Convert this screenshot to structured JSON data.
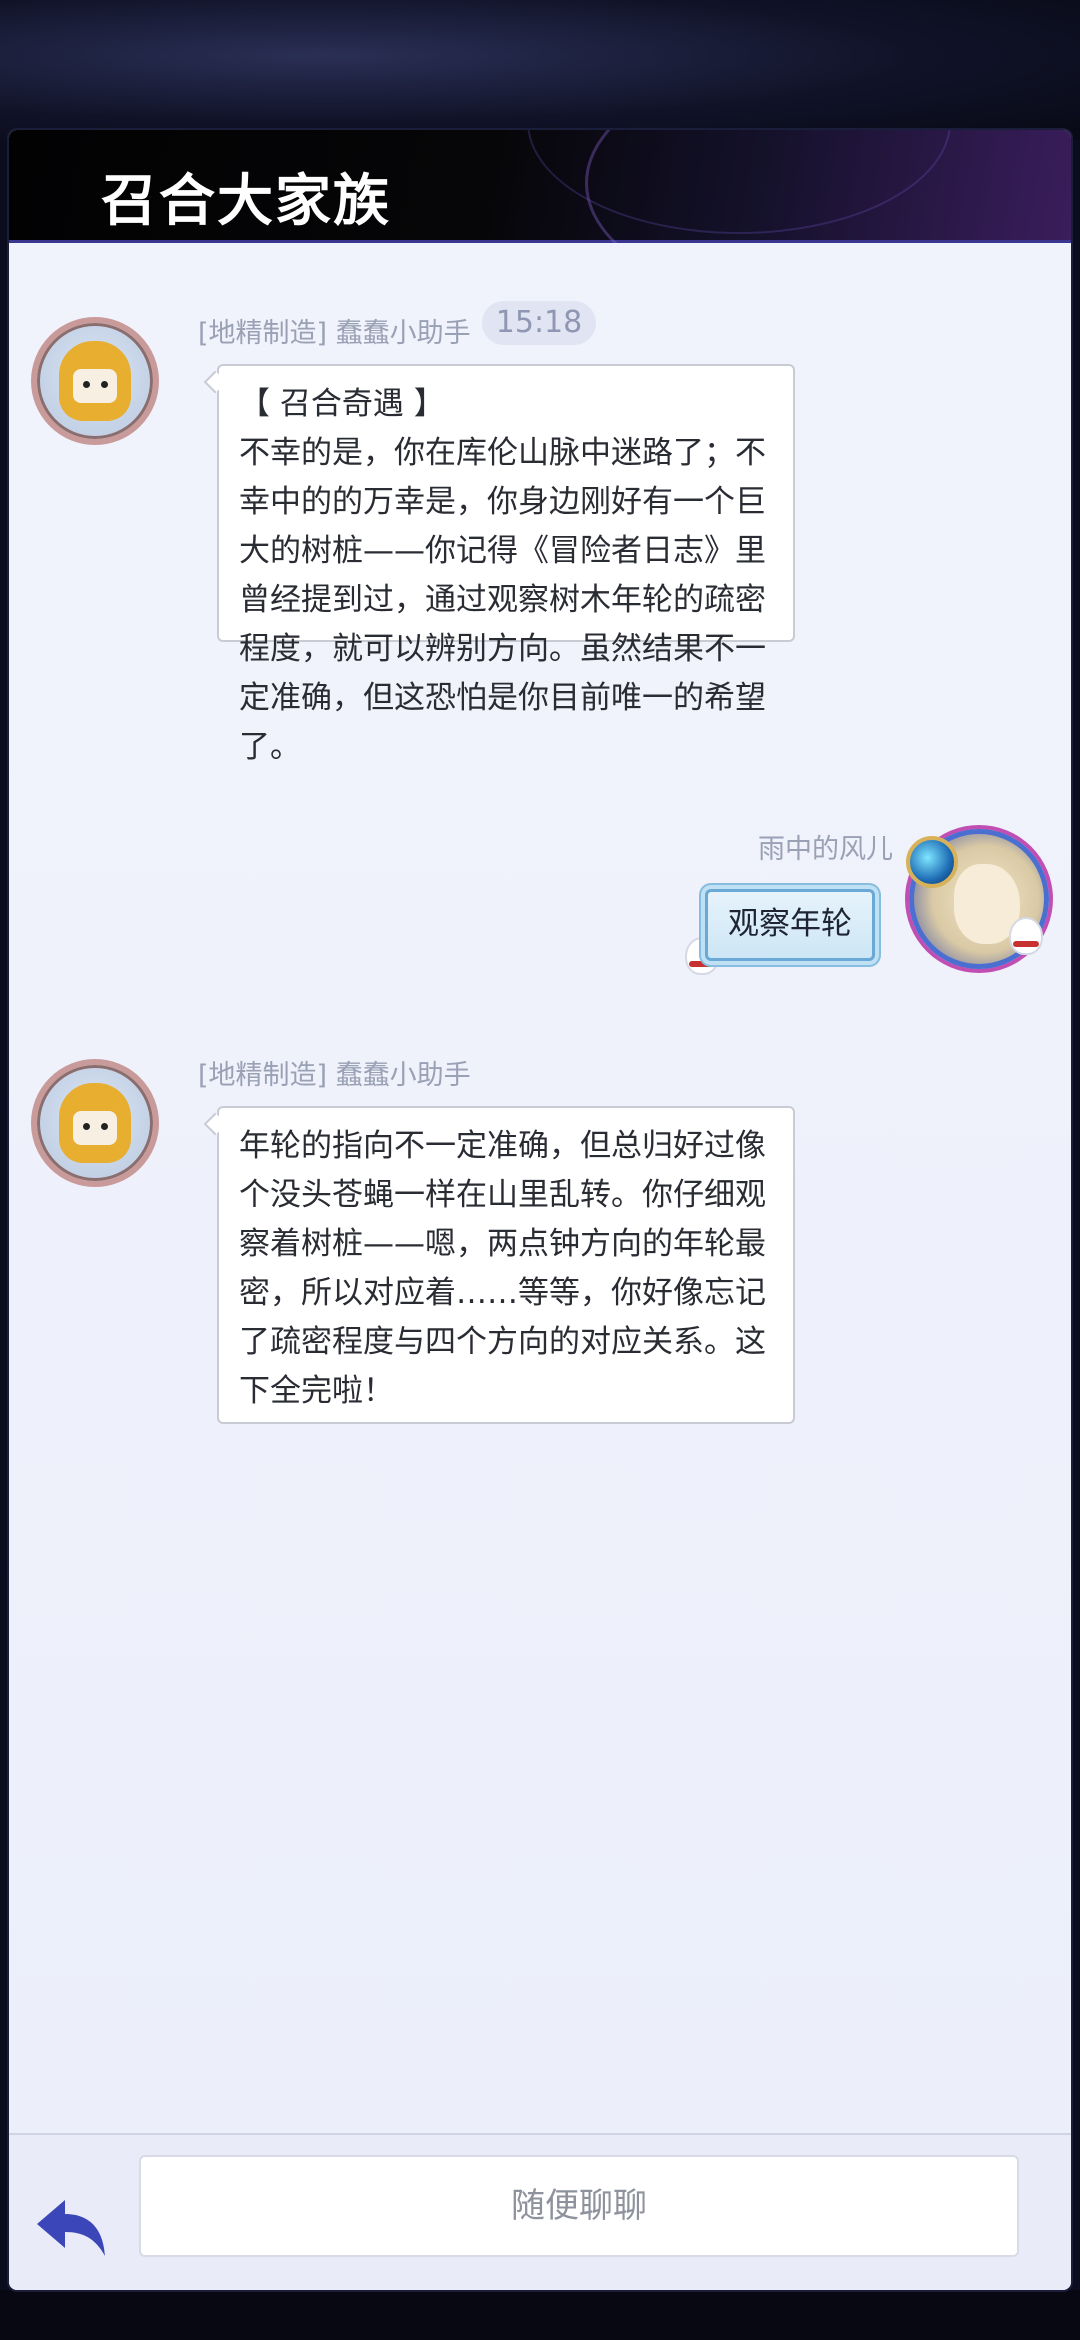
{
  "header": {
    "title": "召合大家族"
  },
  "chat": {
    "timestamp": "15:18",
    "messages": [
      {
        "sender": "[地精制造] 蠢蠢小助手",
        "avatar_icon": "robot-avatar-icon",
        "text": "【 召合奇遇 】\n不幸的是，你在库伦山脉中迷路了；不幸中的的万幸是，你身边刚好有一个巨大的树桩——你记得《冒险者日志》里曾经提到过，通过观察树木年轮的疏密程度，就可以辨别方向。虽然结果不一定准确，但这恐怕是你目前唯一的希望了。"
      },
      {
        "sender": "雨中的风儿",
        "avatar_icon": "user-avatar-icon",
        "text": "观察年轮",
        "from_user": true
      },
      {
        "sender": "[地精制造] 蠢蠢小助手",
        "avatar_icon": "robot-avatar-icon",
        "text": "年轮的指向不一定准确，但总归好过像个没头苍蝇一样在山里乱转。你仔细观察着树桩——嗯，两点钟方向的年轮最密，所以对应着……等等，你好像忘记了疏密程度与四个方向的对应关系。这下全完啦！"
      }
    ]
  },
  "input": {
    "placeholder": "随便聊聊",
    "back_icon": "back-arrow-icon"
  },
  "colors": {
    "accent": "#3b46b8",
    "bubble_border": "#c9cbd4",
    "panel_bg": "#eef1fb"
  }
}
